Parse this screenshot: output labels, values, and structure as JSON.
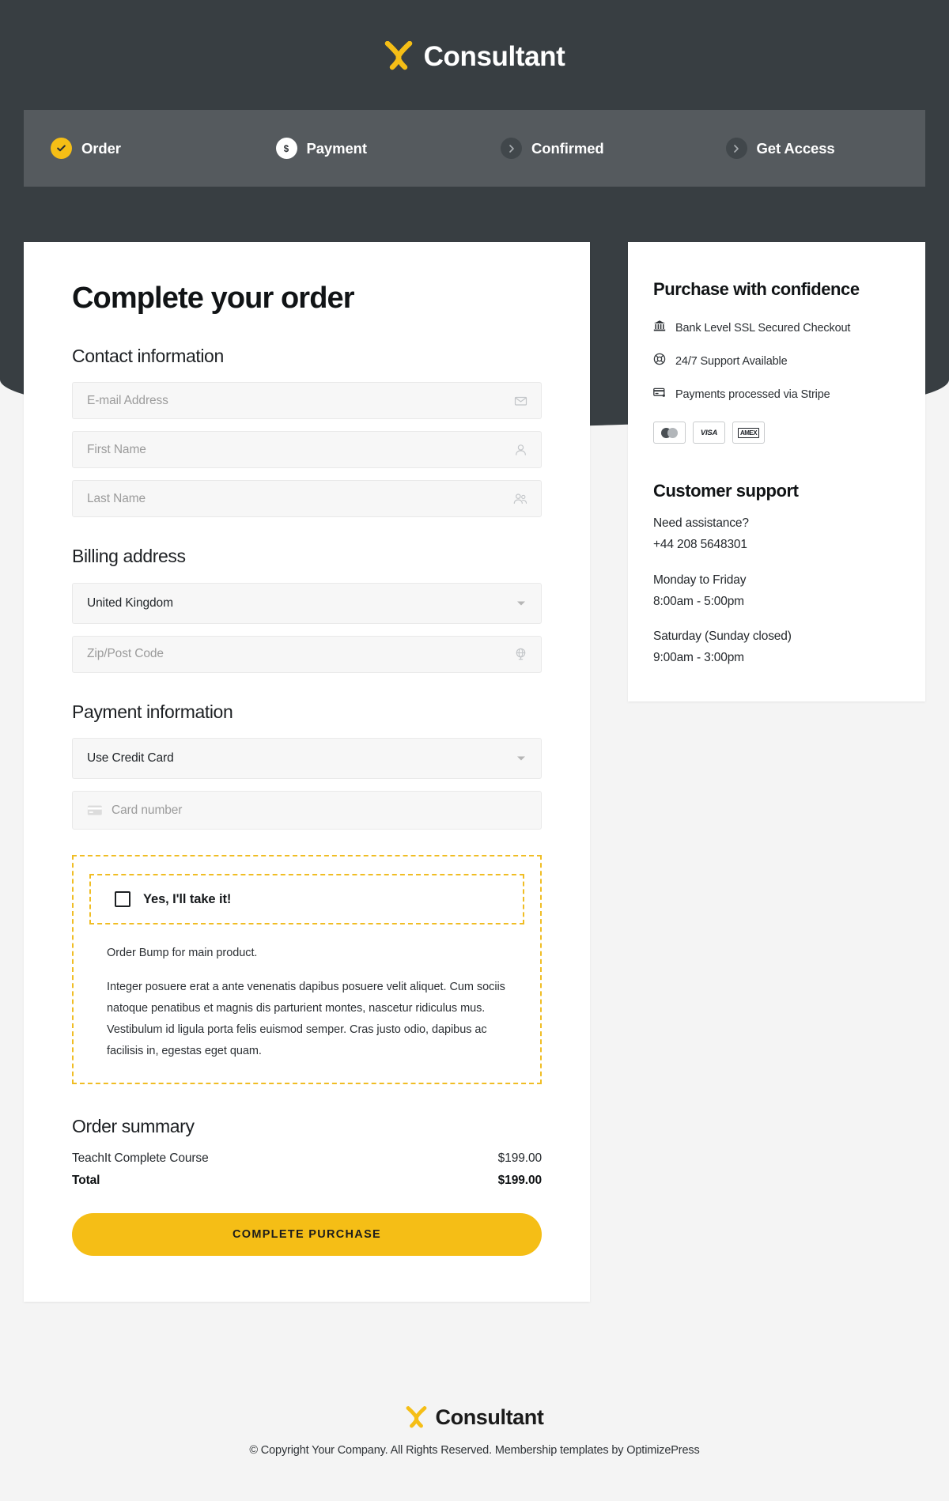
{
  "brand": {
    "name": "Consultant",
    "logo_icon": "x-logo-icon",
    "accent_color": "#f5be16",
    "header_bg": "#383e42",
    "stepbar_bg": "#555a5e"
  },
  "steps": [
    {
      "label": "Order",
      "state": "done",
      "icon": "check-icon"
    },
    {
      "label": "Payment",
      "state": "active",
      "icon": "dollar-icon"
    },
    {
      "label": "Confirmed",
      "state": "todo",
      "icon": "chevron-right-icon"
    },
    {
      "label": "Get Access",
      "state": "todo",
      "icon": "chevron-right-icon"
    }
  ],
  "main": {
    "title": "Complete your order",
    "contact": {
      "heading": "Contact information",
      "fields": [
        {
          "placeholder": "E-mail Address",
          "icon": "envelope-icon"
        },
        {
          "placeholder": "First Name",
          "icon": "person-icon"
        },
        {
          "placeholder": "Last Name",
          "icon": "people-icon"
        }
      ]
    },
    "billing": {
      "heading": "Billing address",
      "country_value": "United Kingdom",
      "zip_placeholder": "Zip/Post Code",
      "zip_icon": "globe-icon"
    },
    "payment": {
      "heading": "Payment information",
      "method_value": "Use Credit Card",
      "card_placeholder": "Card number",
      "card_icon": "credit-card-icon"
    },
    "order_bump": {
      "checkbox_label": "Yes, I'll take it!",
      "checked": false,
      "lead": "Order Bump for main product.",
      "description": "Integer posuere erat a ante venenatis dapibus posuere velit aliquet. Cum sociis natoque penatibus et magnis dis parturient montes, nascetur ridiculus mus. Vestibulum id ligula porta felis euismod semper. Cras justo odio, dapibus ac facilisis in, egestas eget quam.",
      "border_color": "#f0bd24"
    },
    "summary": {
      "heading": "Order summary",
      "items": [
        {
          "name": "TeachIt Complete Course",
          "price": "$199.00"
        }
      ],
      "total_label": "Total",
      "total_price": "$199.00"
    },
    "cta_label": "COMPLETE PURCHASE"
  },
  "sidebar": {
    "confidence": {
      "heading": "Purchase with confidence",
      "items": [
        {
          "text": "Bank Level SSL Secured Checkout",
          "icon": "bank-icon"
        },
        {
          "text": "24/7 Support Available",
          "icon": "lifebuoy-icon"
        },
        {
          "text": "Payments processed via Stripe",
          "icon": "credit-card-icon"
        }
      ],
      "card_badges": [
        {
          "name": "mastercard",
          "label": ""
        },
        {
          "name": "visa",
          "label": "VISA"
        },
        {
          "name": "amex",
          "label": "AMEX"
        }
      ]
    },
    "support": {
      "heading": "Customer support",
      "assistance_label": "Need assistance?",
      "phone": "+44 208 5648301",
      "weekday_label": "Monday to Friday",
      "weekday_hours": "8:00am - 5:00pm",
      "weekend_label": "Saturday (Sunday closed)",
      "weekend_hours": "9:00am - 3:00pm"
    }
  },
  "footer": {
    "brand_name": "Consultant",
    "copyright": "© Copyright Your Company. All Rights Reserved. Membership templates by OptimizePress"
  }
}
